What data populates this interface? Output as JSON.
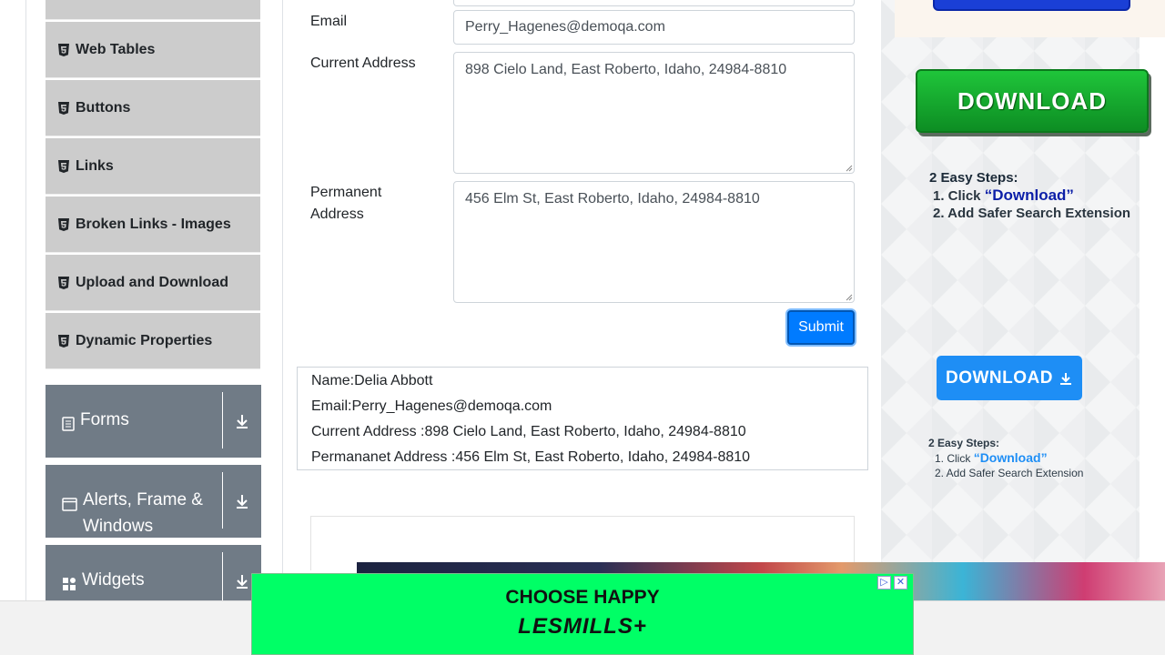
{
  "sidebar": {
    "items": [
      {
        "label": "Web Tables",
        "icon": "html5-icon"
      },
      {
        "label": "Buttons",
        "icon": "html5-icon"
      },
      {
        "label": "Links",
        "icon": "html5-icon"
      },
      {
        "label": "Broken Links - Images",
        "icon": "html5-icon"
      },
      {
        "label": "Upload and Download",
        "icon": "html5-icon"
      },
      {
        "label": "Dynamic Properties",
        "icon": "html5-icon"
      }
    ],
    "groups": [
      {
        "label": "Forms",
        "icon": "form-icon"
      },
      {
        "label": "Alerts, Frame & Windows",
        "icon": "window-icon"
      },
      {
        "label": "Widgets",
        "icon": "widgets-icon"
      }
    ]
  },
  "form": {
    "email_label": "Email",
    "email_value": "Perry_Hagenes@demoqa.com",
    "current_address_label": "Current Address",
    "current_address_value": "898 Cielo Land, East Roberto, Idaho, 24984-8810",
    "permanent_address_label_1": "Permanent",
    "permanent_address_label_2": "Address",
    "permanent_address_value": "456 Elm St, East Roberto, Idaho, 24984-8810",
    "submit_label": "Submit"
  },
  "output": {
    "name": "Name:Delia Abbott",
    "email": "Email:Perry_Hagenes@demoqa.com",
    "current_address": "Current Address :898 Cielo Land, East Roberto, Idaho, 24984-8810",
    "permanent_address": "Permananet Address :456 Elm St, East Roberto, Idaho, 24984-8810"
  },
  "right_ad": {
    "download_big": "DOWNLOAD",
    "steps_title": "2 Easy Steps:",
    "step1_prefix": "1. Click ",
    "step1_highlight": "“Download”",
    "step2": "2. Add Safer Search Extension",
    "download_small": "DOWNLOAD",
    "steps2_title": "2 Easy Steps:",
    "steps2_step1_prefix": "1. Click ",
    "steps2_step1_highlight": "“Download”",
    "steps2_step2": "2. Add Safer Search Extension"
  },
  "bottom_ad": {
    "line1": "CHOOSE HAPPY",
    "line2": "LESMILLS+",
    "adchoices": "▷",
    "close": "✕"
  },
  "colors": {
    "menu_item_bg": "#cccccc",
    "group_bg": "#707b86",
    "submit_bg": "#007bff",
    "download_green": "#1fc53a",
    "download_blue": "#1e8ef5",
    "ad_green": "#00ff66"
  }
}
